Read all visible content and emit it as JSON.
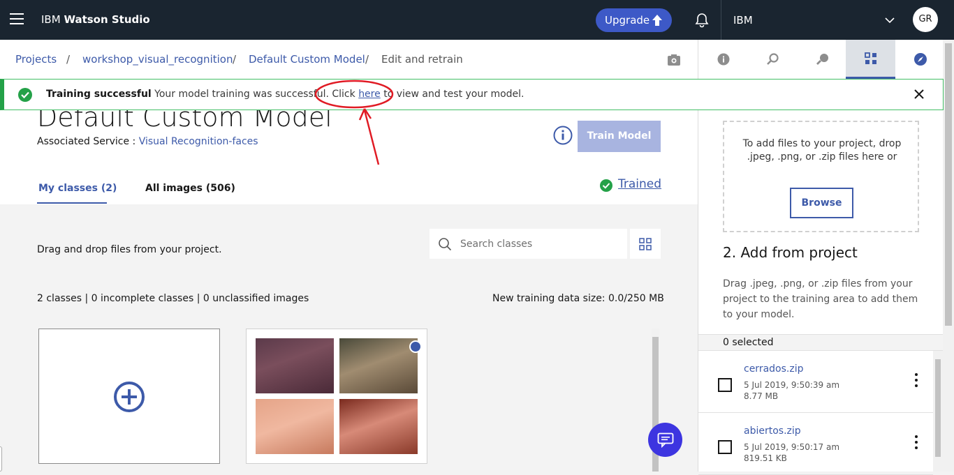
{
  "topbar": {
    "brand_prefix": "IBM ",
    "brand_name": "Watson Studio",
    "upgrade_label": "Upgrade",
    "account": "IBM",
    "avatar_initials": "GR"
  },
  "breadcrumb": {
    "items": [
      "Projects",
      "workshop_visual_recognition",
      "Default Custom Model",
      "Edit and retrain"
    ],
    "separator": "/"
  },
  "notification": {
    "title": "Training successful",
    "message_before": " Your model training was successful. Click ",
    "link": "here",
    "message_after": " to view and test your model."
  },
  "model": {
    "title": "Default Custom Model",
    "assoc_label": "Associated Service : ",
    "assoc_service": "Visual Recognition-faces",
    "train_button": "Train Model",
    "status": "Trained"
  },
  "tabs": [
    {
      "label": "My classes (2)",
      "active": true
    },
    {
      "label": "All images (506)",
      "active": false
    }
  ],
  "classes_area": {
    "drag_text": "Drag and drop files from your project.",
    "search_placeholder": "Search classes",
    "stats": "2 classes | 0 incomplete classes | 0 unclassified images",
    "data_size": "New training data size: 0.0/250 MB"
  },
  "right_panel": {
    "dropzone_text": "To add files to your project, drop .jpeg, .png, or .zip files here or",
    "browse_label": "Browse",
    "section_title": "2. Add from project",
    "section_desc": "Drag .jpeg, .png, or .zip files from your project to the training area to add them to your model.",
    "selected": "0 selected",
    "files": [
      {
        "name": "cerrados.zip",
        "date": "5 Jul 2019, 9:50:39 am",
        "size": "8.77 MB"
      },
      {
        "name": "abiertos.zip",
        "date": "5 Jul 2019, 9:50:17 am",
        "size": "819.51 KB"
      }
    ]
  },
  "colors": {
    "accent": "#3d5aa9",
    "success": "#24a148",
    "topbar": "#1a2530",
    "annotation": "#e01b24"
  }
}
